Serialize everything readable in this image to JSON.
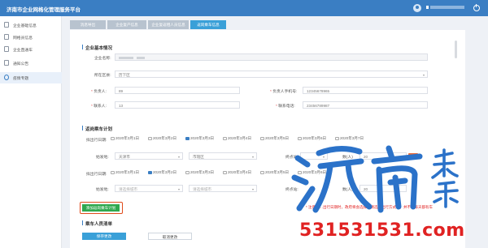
{
  "header": {
    "title": "济南市企业网格化管理服务平台"
  },
  "sidebar": {
    "items": [
      {
        "label": "企业基础信息",
        "icon": "document-icon"
      },
      {
        "label": "网格员信息",
        "icon": "id-card-icon"
      },
      {
        "label": "企业直通车",
        "icon": "car-icon"
      },
      {
        "label": "通知公告",
        "icon": "bell-icon"
      },
      {
        "label": "疫情专题",
        "icon": "virus-icon",
        "active": true
      }
    ]
  },
  "tabs": [
    "消息导出",
    "企业复产信息",
    "企业复返租人员信息",
    "返岗乘车信息"
  ],
  "basic": {
    "section_title": "企业基本情况",
    "company_name_label": "企业名称:",
    "district_label": "所在区县:",
    "district_value": "历下区",
    "owner_label": "负责人:",
    "owner_value": "89",
    "owner_phone_label": "负责人手机号:",
    "owner_phone_value": "12345678965",
    "contact_label": "联系人:",
    "contact_value": "13",
    "contact_phone_label": "联系电话:",
    "contact_phone_value": "23456789987"
  },
  "plan": {
    "section_title": "返岗乘车计划",
    "date_label": "拟出行日期:",
    "dates": [
      "2020年3月1日",
      "2020年3月2日",
      "2020年3月3日",
      "2020年3月4日",
      "2020年3月5日",
      "2020年3月6日",
      "2020年3月7日"
    ],
    "row1_checked_index": 2,
    "row2_checked_index": 1,
    "origin_label": "始发地:",
    "origin_city": "天津市",
    "origin_district": "市辖区",
    "origin_city_placeholder": "请选择城市",
    "origin_district_placeholder": "请选择城市",
    "dest_label": "终点站:",
    "count_label": "数(人)",
    "count_value": "20",
    "count_label_2": "数(人):",
    "count_value_2": "20",
    "add_button": "添加返岗乘车计划",
    "notice": "* 注意：…出行日期时，政府将会选择…请选择出行方式…，并不会每天都有车"
  },
  "staff": {
    "section_title": "乘车人员清单"
  },
  "actions": {
    "save": "保存更改",
    "cancel": "取消更改"
  },
  "watermark": {
    "text": "531531531.com"
  },
  "colors": {
    "header": "#3a7ec3",
    "active_tab": "#3aa0d8",
    "add_button": "#2fa84f",
    "highlight_box": "#e04a1b",
    "watermark": "#e02222"
  }
}
